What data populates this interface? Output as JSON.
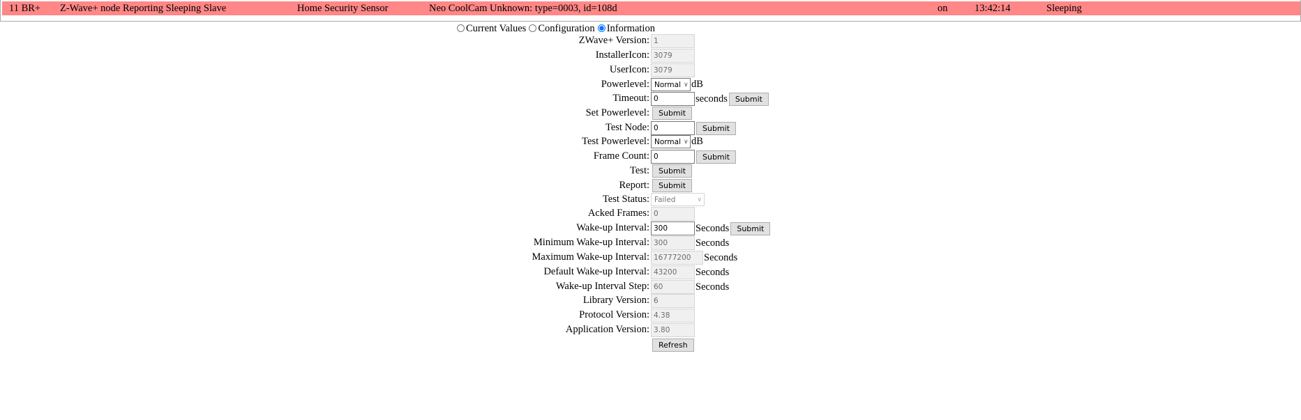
{
  "node": {
    "id": "11 BR+",
    "type": "Z-Wave+ node Reporting Sleeping Slave",
    "role": "Home Security Sensor",
    "product": "Neo CoolCam Unknown: type=0003, id=108d",
    "power": "on",
    "time": "13:42:14",
    "state": "Sleeping",
    "row_color": "#ff8787"
  },
  "tabs": [
    {
      "label": "Current Values",
      "checked": false
    },
    {
      "label": "Configuration",
      "checked": false
    },
    {
      "label": "Information",
      "checked": true
    }
  ],
  "rows": [
    {
      "label": "ZWave+ Version:",
      "kind": "ro",
      "value": "1"
    },
    {
      "label": "InstallerIcon:",
      "kind": "ro",
      "value": "3079"
    },
    {
      "label": "UserIcon:",
      "kind": "ro",
      "value": "3079"
    },
    {
      "label": "Powerlevel:",
      "kind": "select",
      "value": "Normal",
      "suffix": "dB"
    },
    {
      "label": "Timeout:",
      "kind": "input",
      "value": "0",
      "suffix": "seconds",
      "button": "Submit"
    },
    {
      "label": "Set Powerlevel:",
      "kind": "button",
      "button": "Submit"
    },
    {
      "label": "Test Node:",
      "kind": "input",
      "value": "0",
      "button": "Submit"
    },
    {
      "label": "Test Powerlevel:",
      "kind": "select",
      "value": "Normal",
      "suffix": "dB"
    },
    {
      "label": "Frame Count:",
      "kind": "input",
      "value": "0",
      "button": "Submit"
    },
    {
      "label": "Test:",
      "kind": "button",
      "button": "Submit"
    },
    {
      "label": "Report:",
      "kind": "button",
      "button": "Submit"
    },
    {
      "label": "Test Status:",
      "kind": "select-disabled",
      "value": "Failed"
    },
    {
      "label": "Acked Frames:",
      "kind": "ro",
      "value": "0"
    },
    {
      "label": "Wake-up Interval:",
      "kind": "input",
      "value": "300",
      "suffix": "Seconds",
      "button": "Submit"
    },
    {
      "label": "Minimum Wake-up Interval:",
      "kind": "ro",
      "value": "300",
      "suffix": "Seconds"
    },
    {
      "label": "Maximum Wake-up Interval:",
      "kind": "ro-wide",
      "value": "16777200",
      "suffix": "Seconds"
    },
    {
      "label": "Default Wake-up Interval:",
      "kind": "ro",
      "value": "43200",
      "suffix": "Seconds"
    },
    {
      "label": "Wake-up Interval Step:",
      "kind": "ro",
      "value": "60",
      "suffix": "Seconds"
    },
    {
      "label": "Library Version:",
      "kind": "ro",
      "value": "6"
    },
    {
      "label": "Protocol Version:",
      "kind": "ro",
      "value": "4.38"
    },
    {
      "label": "Application Version:",
      "kind": "ro",
      "value": "3.80"
    },
    {
      "label": "",
      "kind": "button",
      "button": "Refresh"
    }
  ]
}
